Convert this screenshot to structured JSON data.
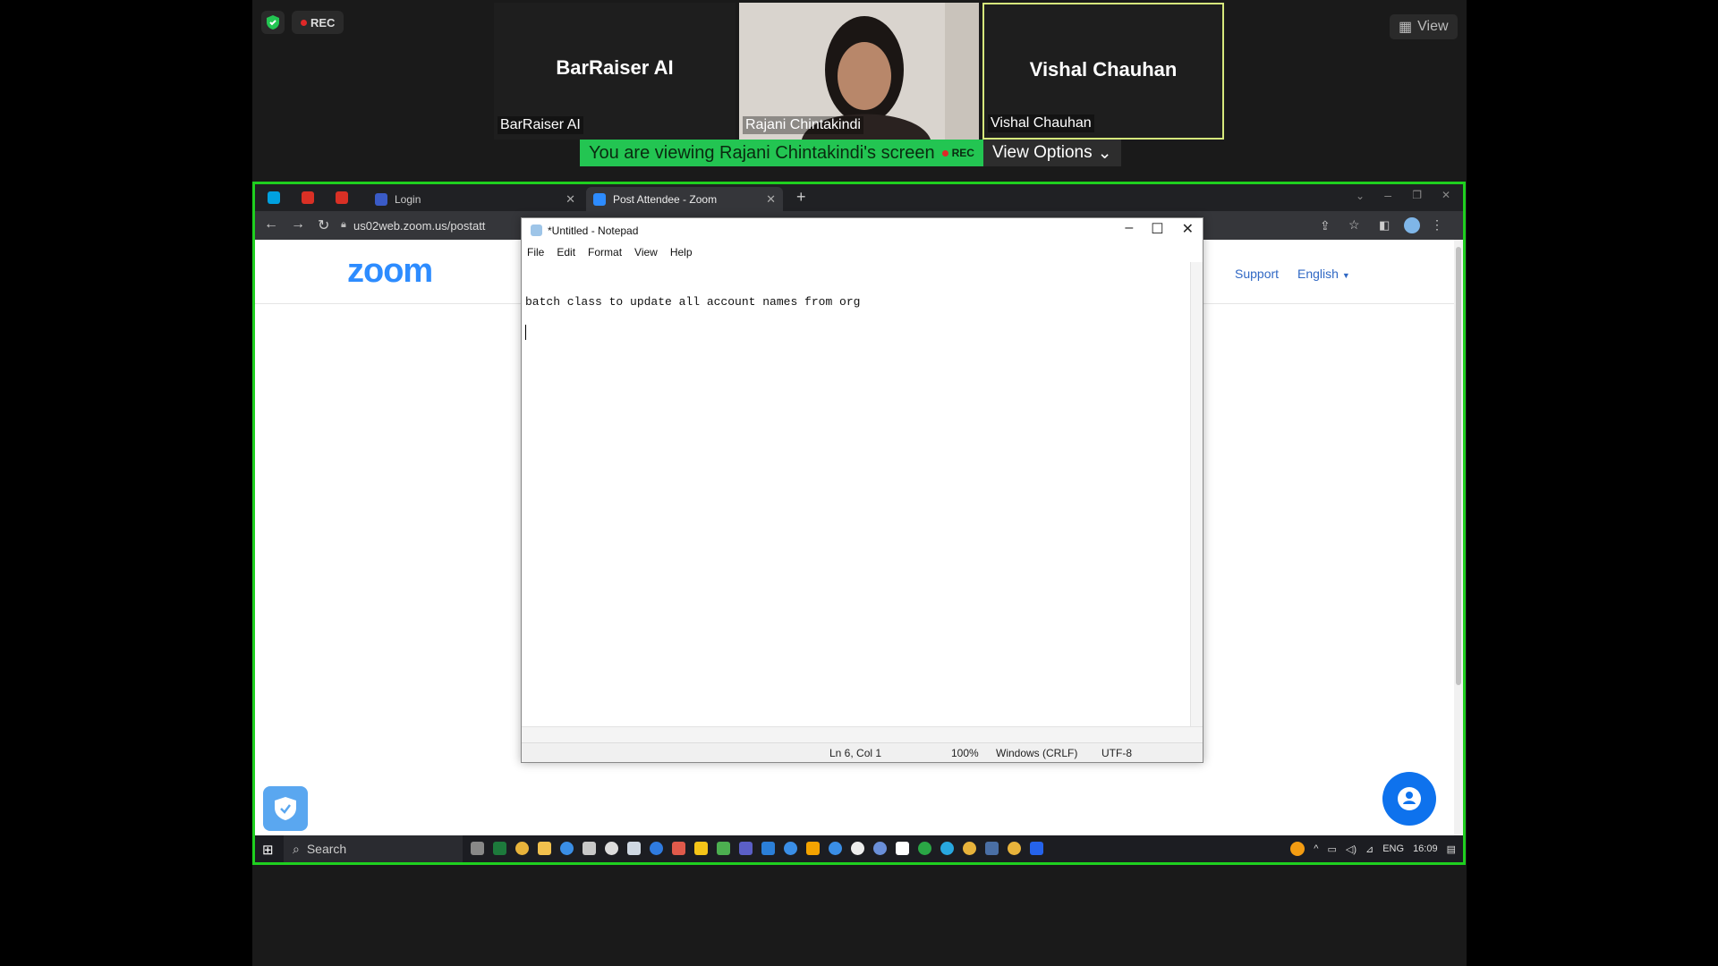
{
  "meeting": {
    "rec_label": "REC",
    "view_label": "View",
    "viewing_message": "You are viewing Rajani Chintakindi's screen",
    "viewing_rec": "REC",
    "view_options_label": "View Options",
    "participants": [
      {
        "display_name": "BarRaiser AI",
        "label": "BarRaiser AI"
      },
      {
        "display_name": "",
        "label": "Rajani Chintakindi"
      },
      {
        "display_name": "Vishal Chauhan",
        "label": "Vishal Chauhan"
      }
    ]
  },
  "browser": {
    "tabs": [
      {
        "label": "Login"
      },
      {
        "label": "Post Attendee - Zoom"
      }
    ],
    "url": "us02web.zoom.us/postatt"
  },
  "zoom_page": {
    "logo": "zoom",
    "support_link": "Support",
    "language": "English"
  },
  "notepad": {
    "title": "*Untitled - Notepad",
    "menu": [
      "File",
      "Edit",
      "Format",
      "View",
      "Help"
    ],
    "content_line": "batch class to update all account names from org",
    "status": {
      "position": "Ln 6, Col 1",
      "zoom": "100%",
      "line_ending": "Windows (CRLF)",
      "encoding": "UTF-8"
    }
  },
  "taskbar": {
    "search_label": "Search",
    "language": "ENG",
    "time": "16:09"
  },
  "colors": {
    "share_border": "#1fd01f",
    "zoom_blue": "#2d8cff",
    "active_speaker": "#d6e87c"
  }
}
